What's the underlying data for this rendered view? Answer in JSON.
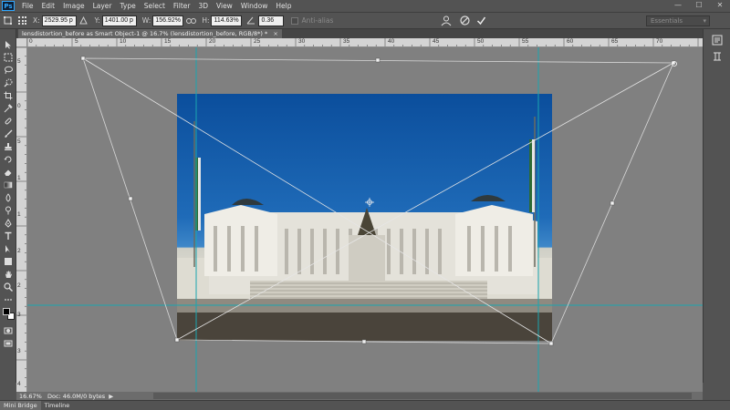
{
  "app": {
    "logo": "Ps"
  },
  "menu": [
    "File",
    "Edit",
    "Image",
    "Layer",
    "Type",
    "Select",
    "Filter",
    "3D",
    "View",
    "Window",
    "Help"
  ],
  "window_controls": [
    "—",
    "☐",
    "✕"
  ],
  "options": {
    "x_label": "X:",
    "x_value": "2529.95 p",
    "y_label": "Y:",
    "y_value": "1401.00 p",
    "w_label": "W:",
    "w_value": "156.92%",
    "h_label": "H:",
    "h_value": "114.63%",
    "angle_value": "0.36",
    "antialias_label": "Anti-alias",
    "workspace": "Essentials"
  },
  "document": {
    "tab_title": "lensdistortion_before as Smart Object-1 @ 16.7% (lensdistortion_before, RGB/8*) *",
    "close": "×"
  },
  "ruler_top_labels": [
    "0",
    "5",
    "10",
    "15",
    "20",
    "25",
    "30",
    "35",
    "40",
    "45",
    "50",
    "55",
    "60",
    "65",
    "70"
  ],
  "ruler_left_labels": [
    "5",
    "0",
    "5",
    "1",
    "1",
    "2",
    "2",
    "3",
    "3",
    "4"
  ],
  "status": {
    "zoom": "16.67%",
    "doc_info": "Doc: 46.0M/0 bytes",
    "arrow": "▶"
  },
  "bottom_tabs": [
    "Mini Bridge",
    "Timeline"
  ],
  "colors": {
    "chrome": "#535353",
    "canvas": "#808080",
    "guide": "#1aa6b0",
    "ruler": "#d4d4d4"
  }
}
